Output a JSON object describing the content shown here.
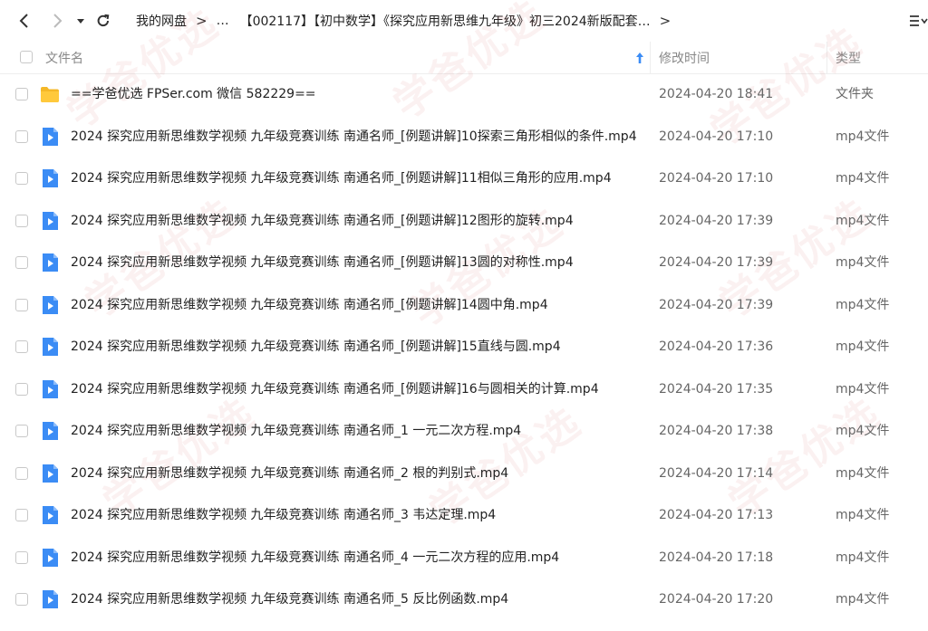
{
  "nav": {
    "breadcrumbs": [
      "我的网盘",
      "…",
      "【002117】【初中数学】《探究应用新思维九年级》初三2024新版配套…"
    ]
  },
  "columns": {
    "name": "文件名",
    "modified": "修改时间",
    "type": "类型"
  },
  "colors": {
    "accent": "#3b8cf5",
    "folder": "#f5b828",
    "video": "#3b8cf5"
  },
  "files": [
    {
      "name": "==学爸优选 FPSer.com 微信 582229==",
      "modified": "2024-04-20 18:41",
      "type": "文件夹",
      "icon": "folder-icon"
    },
    {
      "name": "2024 探究应用新思维数学视频 九年级竞赛训练 南通名师_[例题讲解]10探索三角形相似的条件.mp4",
      "modified": "2024-04-20 17:10",
      "type": "mp4文件",
      "icon": "video-file-icon"
    },
    {
      "name": "2024 探究应用新思维数学视频 九年级竞赛训练 南通名师_[例题讲解]11相似三角形的应用.mp4",
      "modified": "2024-04-20 17:10",
      "type": "mp4文件",
      "icon": "video-file-icon"
    },
    {
      "name": "2024 探究应用新思维数学视频 九年级竞赛训练 南通名师_[例题讲解]12图形的旋转.mp4",
      "modified": "2024-04-20 17:39",
      "type": "mp4文件",
      "icon": "video-file-icon"
    },
    {
      "name": "2024 探究应用新思维数学视频 九年级竞赛训练 南通名师_[例题讲解]13圆的对称性.mp4",
      "modified": "2024-04-20 17:39",
      "type": "mp4文件",
      "icon": "video-file-icon"
    },
    {
      "name": "2024 探究应用新思维数学视频 九年级竞赛训练 南通名师_[例题讲解]14圆中角.mp4",
      "modified": "2024-04-20 17:39",
      "type": "mp4文件",
      "icon": "video-file-icon"
    },
    {
      "name": "2024 探究应用新思维数学视频 九年级竞赛训练 南通名师_[例题讲解]15直线与圆.mp4",
      "modified": "2024-04-20 17:36",
      "type": "mp4文件",
      "icon": "video-file-icon"
    },
    {
      "name": "2024 探究应用新思维数学视频 九年级竞赛训练 南通名师_[例题讲解]16与圆相关的计算.mp4",
      "modified": "2024-04-20 17:35",
      "type": "mp4文件",
      "icon": "video-file-icon"
    },
    {
      "name": "2024 探究应用新思维数学视频 九年级竞赛训练 南通名师_1 一元二次方程.mp4",
      "modified": "2024-04-20 17:38",
      "type": "mp4文件",
      "icon": "video-file-icon"
    },
    {
      "name": "2024 探究应用新思维数学视频 九年级竞赛训练 南通名师_2 根的判别式.mp4",
      "modified": "2024-04-20 17:14",
      "type": "mp4文件",
      "icon": "video-file-icon"
    },
    {
      "name": "2024 探究应用新思维数学视频 九年级竞赛训练 南通名师_3 韦达定理.mp4",
      "modified": "2024-04-20 17:13",
      "type": "mp4文件",
      "icon": "video-file-icon"
    },
    {
      "name": "2024 探究应用新思维数学视频 九年级竞赛训练 南通名师_4 一元二次方程的应用.mp4",
      "modified": "2024-04-20 17:18",
      "type": "mp4文件",
      "icon": "video-file-icon"
    },
    {
      "name": "2024 探究应用新思维数学视频 九年级竞赛训练 南通名师_5 反比例函数.mp4",
      "modified": "2024-04-20 17:20",
      "type": "mp4文件",
      "icon": "video-file-icon"
    }
  ]
}
